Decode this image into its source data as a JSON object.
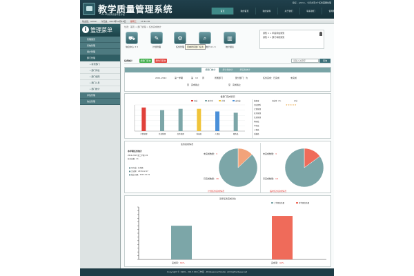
{
  "header": {
    "title": "教学质量管理系统",
    "subtitle": "2013年教学质量年度评估",
    "note": "您好，admin，今日共有4个任务需要处理",
    "nav": [
      "首页",
      "我的首页",
      "我的资料",
      "关于我们",
      "联系我们",
      "使用帮助"
    ]
  },
  "infobar": {
    "user": "欢迎您：admin",
    "date": "今天是：2013年12月18日",
    "weekday": "星期三",
    "time": "17:41:30"
  },
  "sidebar": {
    "title": "管理菜单",
    "subtitle": "MANAGEMENT MENU",
    "items": [
      {
        "label": "管理首页",
        "type": "group"
      },
      {
        "label": "系统管理",
        "type": "group"
      },
      {
        "label": "用户管理",
        "type": "group"
      },
      {
        "label": "部门管理",
        "type": "group",
        "active": true
      },
      {
        "label": "新增部门",
        "type": "sub"
      },
      {
        "label": "部门列表",
        "type": "sub"
      },
      {
        "label": "部门权限",
        "type": "sub"
      },
      {
        "label": "部门人员",
        "type": "sub"
      },
      {
        "label": "部门统计",
        "type": "sub"
      },
      {
        "label": "评估管理",
        "type": "group"
      },
      {
        "label": "信息管理",
        "type": "group"
      }
    ]
  },
  "main": {
    "breadcrumb": "位置：首页 > 部门管理 > 任务完成统计",
    "tools": [
      {
        "label": "信息中心 3 3",
        "icon": "truck"
      },
      {
        "label": "计划管理",
        "icon": "tools"
      },
      {
        "label": "任务管理",
        "icon": "gear"
      },
      {
        "label": "任务完成统计 0 1 3",
        "icon": "search"
      },
      {
        "label": "统计报表",
        "icon": "bar-chart"
      }
    ],
    "tooltip": "查看所有部门任务",
    "notices": [
      "通知 1 > 年度评估通知",
      "通知 2 > 部门考核通知"
    ],
    "section_title": "任务统计",
    "btn_green": "按部门查询",
    "btn_red": "按时间查询",
    "search_placeholder": "请输入关键字",
    "search_button": "查询"
  },
  "filter": {
    "tabs": [
      "按部门统计",
      "按计划统计",
      "按任务统计"
    ],
    "year_label": "2011-2012",
    "term_label": "第一学期",
    "week_label": "第",
    "week_value": "13",
    "week_suffix": "周",
    "dept_label": "所属部门",
    "type_label": "部分部门：为",
    "done_label": "任务完成：已完成",
    "undone_label": "未完成",
    "range_label": "至",
    "range_value": "完成截止",
    "end_label": "至",
    "end_value": "完成截止"
  },
  "dept_chart": {
    "title": "各部门完成情况",
    "satisfaction_header": "满意度",
    "satisfaction_col2": "完成率（%）",
    "satisfaction_col3": "评分",
    "satisfaction_rows": [
      "完成优秀",
      "计划管理",
      "任务管理",
      "信息管理",
      "科研处",
      "学生处",
      "人事处",
      "后勤处"
    ],
    "stars": "★★★★★"
  },
  "chart_data": [
    {
      "type": "bar",
      "title": "各部门完成情况",
      "categories": [
        "计划管理",
        "信息管理",
        "任务管理",
        "科研处",
        "人事处",
        "教务处"
      ],
      "series": [
        {
          "name": "完成",
          "color": "#e0413b",
          "values": [
            0,
            0,
            0,
            0,
            0,
            0
          ]
        },
        {
          "name": "进行中",
          "color": "#7ca6a8",
          "values": [
            0,
            0,
            0,
            0,
            0,
            0
          ]
        },
        {
          "name": "计划",
          "color": "#f0c43a",
          "values": [
            0,
            0,
            0,
            0,
            0,
            0
          ]
        },
        {
          "name": "未完成",
          "color": "#4a90d9",
          "values": [
            0,
            0,
            0,
            0,
            0,
            0
          ]
        }
      ],
      "values": [
        90,
        80,
        85,
        85,
        75,
        70
      ],
      "bar_colors": [
        "#e0413b",
        "#7ca6a8",
        "#7ca6a8",
        "#f0c43a",
        "#4a90d9",
        "#7ca6a8"
      ],
      "ylim": [
        0,
        100
      ]
    },
    {
      "type": "pie",
      "title": "任务完成情况",
      "slices": [
        {
          "label": "未完成",
          "value": 13,
          "color": "#f2a37a"
        },
        {
          "label": "已完成",
          "value": 87,
          "color": "#7ca6a8"
        }
      ]
    },
    {
      "type": "pie",
      "title": "任务完成情况",
      "slices": [
        {
          "label": "未完成",
          "value": 15,
          "color": "#ef6b5a"
        },
        {
          "label": "已完成",
          "value": 85,
          "color": "#7ca6a8"
        }
      ]
    },
    {
      "type": "bar",
      "title": "年度任务完成对比",
      "categories": [
        "完成率",
        "完成率"
      ],
      "series": [
        {
          "name": "上学期任务量",
          "color": "#7ca6a8",
          "values": [
            45
          ]
        },
        {
          "name": "本学期任务量",
          "color": "#ef6b5a",
          "values": [
            58
          ]
        }
      ],
      "values": [
        45,
        58
      ],
      "ylim": [
        0,
        70
      ]
    }
  ],
  "completion_panel": {
    "title": "任务完成情况",
    "stat_title": "本学期任务统计",
    "stat_lines": [
      "2012-2013 第二学期  1/2",
      "任务总数：21"
    ],
    "legend": [
      "已完成：任务数",
      "完成率：2013-12-17",
      "截止日期：2013-12-31"
    ],
    "pie1": {
      "undone_label": "未完成数量：",
      "undone_value": "3",
      "done_label": "已完成数量：",
      "done_value": "18",
      "caption": "计划任务完成情况"
    },
    "pie2": {
      "undone_label": "未完成数量：",
      "undone_value": "3",
      "done_label": "已完成数量：",
      "done_value": "18",
      "caption": "临时任务完成情况"
    }
  },
  "year_chart": {
    "title": "近年任务完成对比",
    "legend1": "上学期任务量",
    "legend2": "本学期任务量",
    "label1": "完成率：",
    "label1_value": "80%",
    "label2": "完成率：",
    "label2_value": "90%"
  },
  "footer": {
    "text": "Copyright © 1999 - 2013  XXX工作室 - Professional Studio. All Rights Reserved"
  }
}
